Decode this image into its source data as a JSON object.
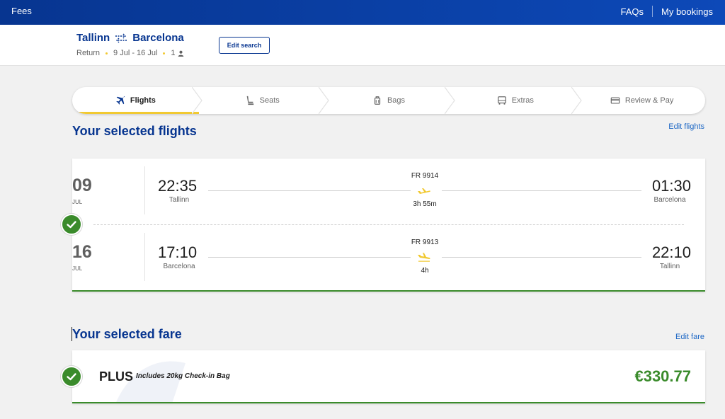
{
  "topnav": {
    "fees": "Fees",
    "faqs": "FAQs",
    "bookings": "My bookings"
  },
  "search": {
    "origin": "Tallinn",
    "destination": "Barcelona",
    "trip_type": "Return",
    "dates": "9 Jul - 16 Jul",
    "passengers": "1",
    "edit_label": "Edit search"
  },
  "steps": [
    {
      "label": "Flights",
      "icon": "plane-icon",
      "active": true
    },
    {
      "label": "Seats",
      "icon": "seat-icon",
      "active": false
    },
    {
      "label": "Bags",
      "icon": "bag-icon",
      "active": false
    },
    {
      "label": "Extras",
      "icon": "bus-icon",
      "active": false
    },
    {
      "label": "Review & Pay",
      "icon": "card-icon",
      "active": false
    }
  ],
  "flights_section": {
    "title": "Your selected flights",
    "edit_label": "Edit flights",
    "legs": [
      {
        "day": "09",
        "month": "JUL",
        "dep_time": "22:35",
        "dep_city": "Tallinn",
        "flight_no": "FR 9914",
        "duration": "3h 55m",
        "arr_time": "01:30",
        "arr_city": "Barcelona"
      },
      {
        "day": "16",
        "month": "JUL",
        "dep_time": "17:10",
        "dep_city": "Barcelona",
        "flight_no": "FR 9913",
        "duration": "4h",
        "arr_time": "22:10",
        "arr_city": "Tallinn"
      }
    ]
  },
  "fare_section": {
    "title": "Your selected fare",
    "edit_label": "Edit fare",
    "fare_name": "PLUS",
    "fare_desc": "Includes 20kg Check-in Bag",
    "price": "€330.77"
  },
  "colors": {
    "brand_blue": "#073590",
    "accent_yellow": "#f1c931",
    "success_green": "#3a8b2b",
    "link_blue": "#1e68c5"
  }
}
